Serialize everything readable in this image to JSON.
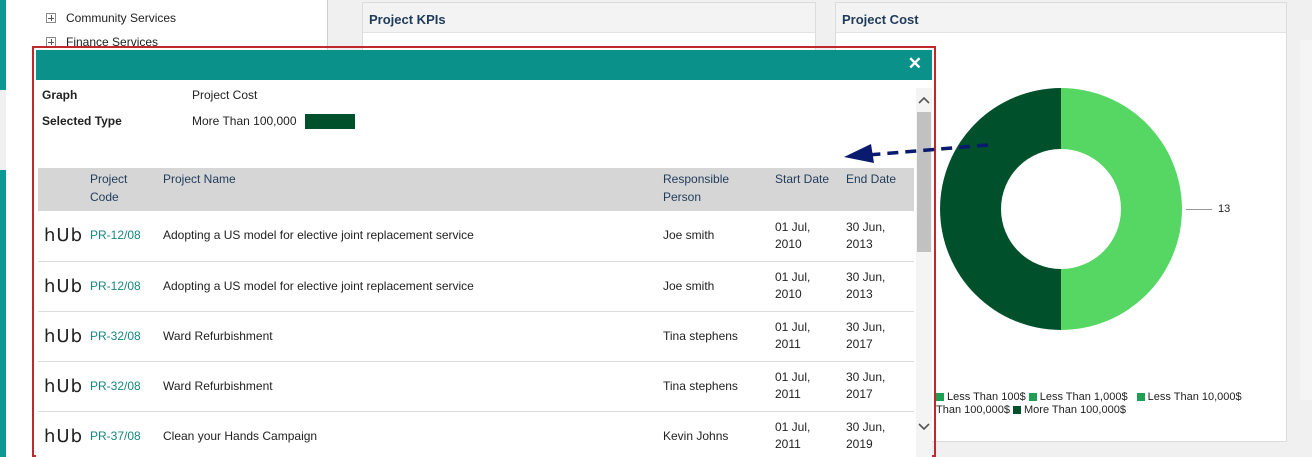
{
  "tree": {
    "items": [
      {
        "label": "Community Services"
      },
      {
        "label": "Finance Services"
      }
    ]
  },
  "panels": {
    "kpi_title": "Project KPIs",
    "cost_title": "Project Cost"
  },
  "chart_data": {
    "type": "pie",
    "categories": [
      "Less Than 100$",
      "Less Than 1,000$",
      "Less Than 10,000$",
      "Less Than 100,000$",
      "More Than 100,000$"
    ],
    "values": [
      13,
      0,
      0,
      0,
      13
    ],
    "data_labels": [
      "13"
    ],
    "legend_placement": "bottom",
    "colors": [
      "#56d763",
      "#2fa04a",
      "#1d9a55",
      "#0f7a3e",
      "#00502c"
    ]
  },
  "legend": {
    "items": [
      {
        "label": "Less Than 100$",
        "color": "#1f9f52"
      },
      {
        "label": "Less Than 1,000$",
        "color": "#1f9f52"
      },
      {
        "label": "Less Than 10,000$",
        "color": "#1f9f52"
      },
      {
        "label": "Than 100,000$",
        "color": "#0f7a3e"
      },
      {
        "label": "More Than 100,000$",
        "color": "#00502c"
      }
    ],
    "donut_label": "13"
  },
  "modal": {
    "close_glyph": "✕",
    "graph_label": "Graph",
    "graph_value": "Project Cost",
    "type_label": "Selected Type",
    "type_value": "More Than 100,000",
    "type_color": "#00502c",
    "columns": [
      "",
      "Project Code",
      "Project Name",
      "Responsible Person",
      "Start Date",
      "End Date"
    ],
    "rows": [
      {
        "logo": "hUb",
        "code": "PR-12/08",
        "name": "Adopting a US model for elective joint replacement service",
        "person": "Joe smith",
        "start": "01 Jul, 2010",
        "end": "30 Jun, 2013"
      },
      {
        "logo": "hUb",
        "code": "PR-12/08",
        "name": "Adopting a US model for elective joint replacement service",
        "person": "Joe smith",
        "start": "01 Jul, 2010",
        "end": "30 Jun, 2013"
      },
      {
        "logo": "hUb",
        "code": "PR-32/08",
        "name": "Ward Refurbishment",
        "person": "Tina stephens",
        "start": "01 Jul, 2011",
        "end": "30 Jun, 2017"
      },
      {
        "logo": "hUb",
        "code": "PR-32/08",
        "name": "Ward Refurbishment",
        "person": "Tina stephens",
        "start": "01 Jul, 2011",
        "end": "30 Jun, 2017"
      },
      {
        "logo": "hUb",
        "code": "PR-37/08",
        "name": "Clean your Hands Campaign",
        "person": "Kevin Johns",
        "start": "01 Jul, 2011",
        "end": "30 Jun, 2019"
      }
    ]
  },
  "colors": {
    "teal": "#0a918a",
    "outline_red": "#c0292b",
    "arrow_navy": "#0a1a6e"
  }
}
